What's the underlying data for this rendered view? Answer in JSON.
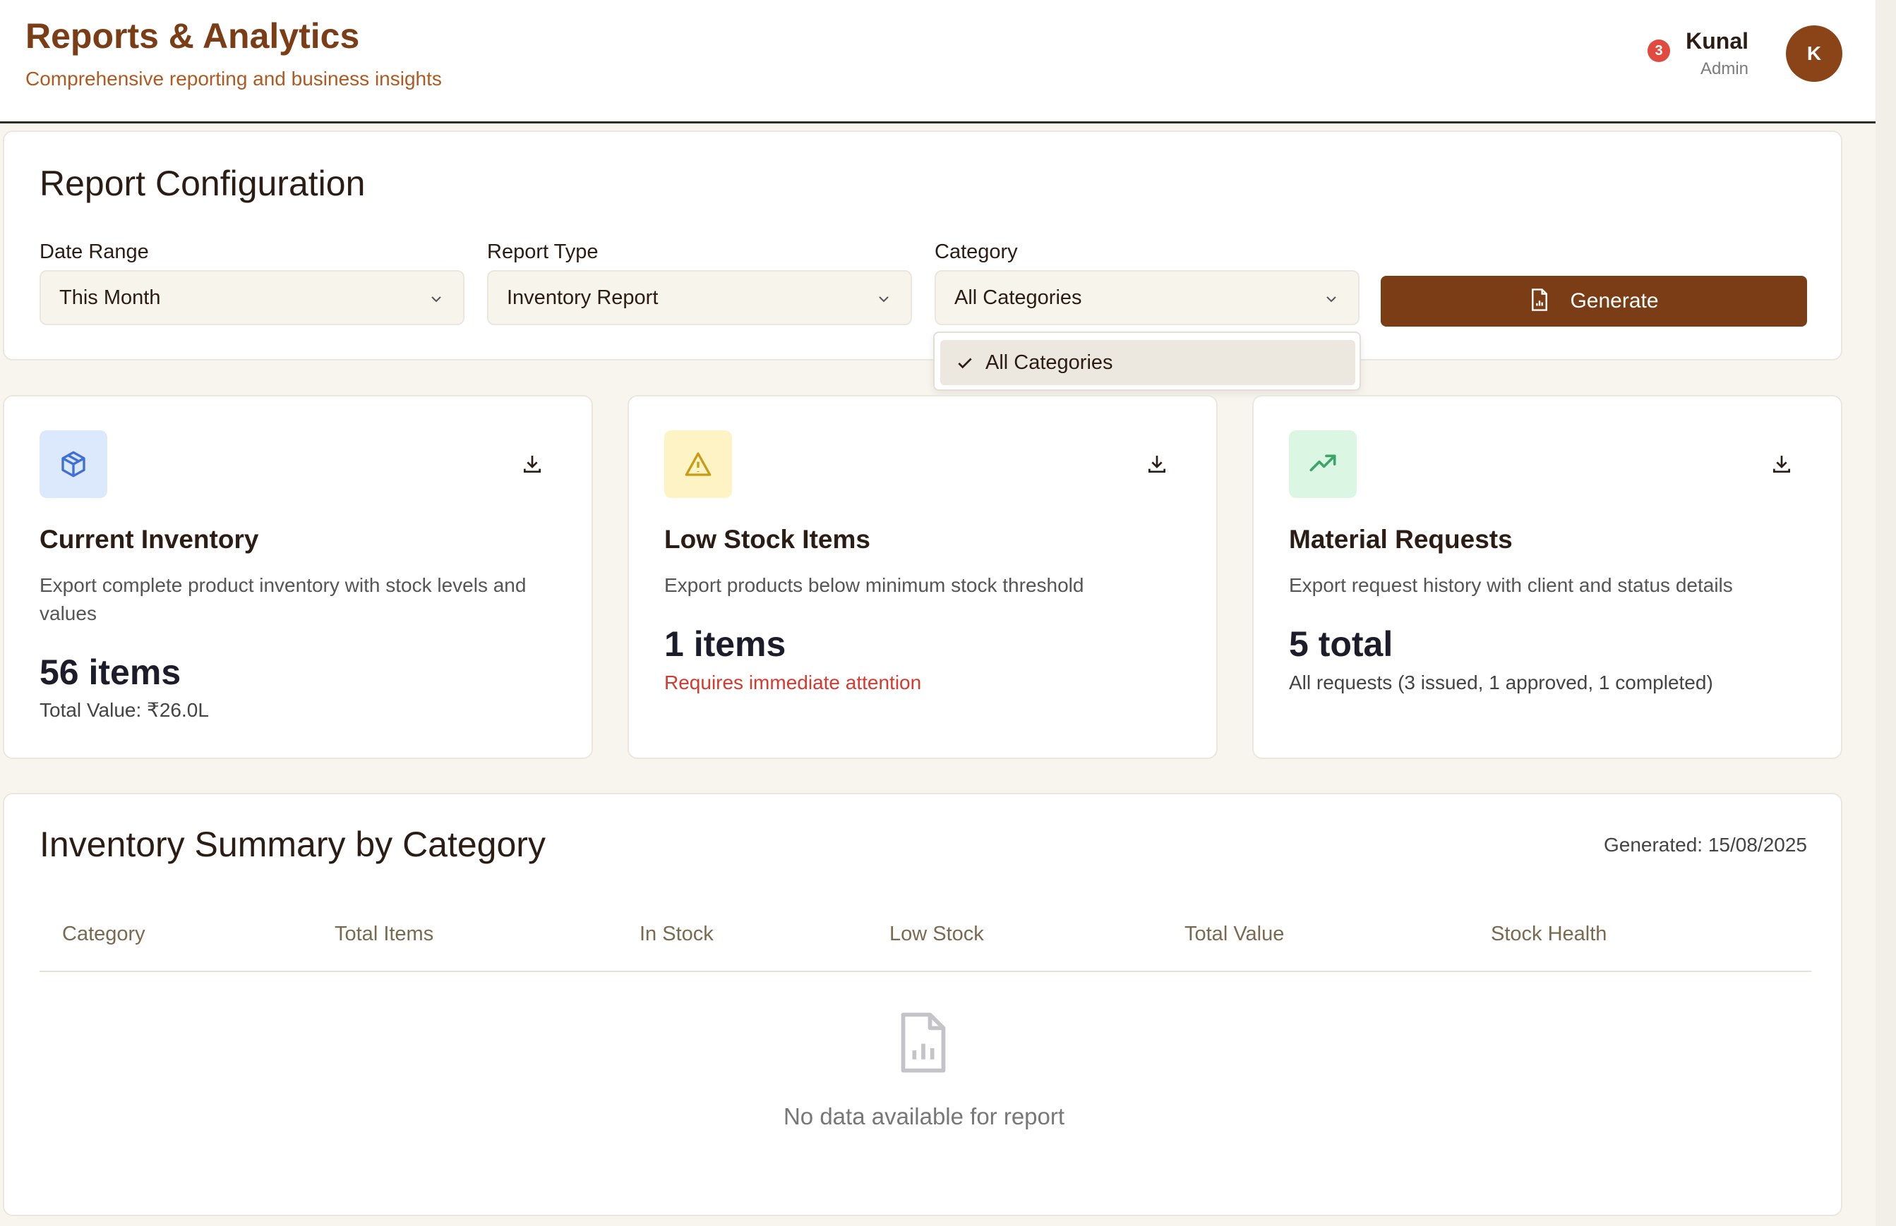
{
  "header": {
    "title": "Reports & Analytics",
    "subtitle": "Comprehensive reporting and business insights",
    "notification_count": "3",
    "user_name": "Kunal",
    "user_role": "Admin",
    "avatar_initial": "K"
  },
  "config": {
    "title": "Report Configuration",
    "date_range_label": "Date Range",
    "date_range_value": "This Month",
    "report_type_label": "Report Type",
    "report_type_value": "Inventory Report",
    "category_label": "Category",
    "category_value": "All Categories",
    "generate_label": "Generate",
    "category_options": [
      "All Categories"
    ]
  },
  "cards": [
    {
      "icon": "package-icon",
      "title": "Current Inventory",
      "description": "Export complete product inventory with stock levels and values",
      "big": "56 items",
      "note": "Total Value: ₹26.0L",
      "color": "#3f6fd8"
    },
    {
      "icon": "warning-icon",
      "title": "Low Stock Items",
      "description": "Export products below minimum stock threshold",
      "big": "1 items",
      "note": "Requires immediate attention",
      "color": "#c99a12"
    },
    {
      "icon": "trending-up-icon",
      "title": "Material Requests",
      "description": "Export request history with client and status details",
      "big": "5 total",
      "note": "All requests (3 issued, 1 approved, 1 completed)",
      "color": "#3ea56a"
    }
  ],
  "summary": {
    "title": "Inventory Summary by Category",
    "generated": "Generated: 15/08/2025",
    "columns": [
      "Category",
      "Total Items",
      "In Stock",
      "Low Stock",
      "Total Value",
      "Stock Health"
    ],
    "empty_text": "No data available for report"
  },
  "colors": {
    "brand": "#7a3d16",
    "alert": "#d63a2f"
  }
}
